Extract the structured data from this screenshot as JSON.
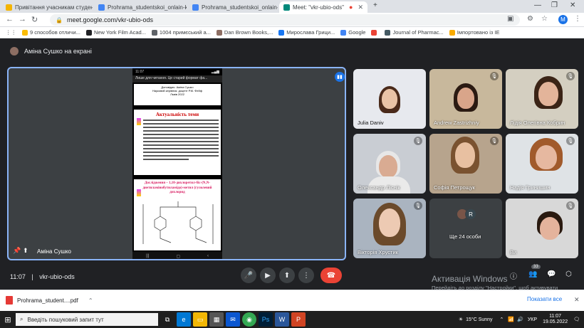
{
  "browser": {
    "tabs": [
      {
        "title": "Привітання учасникам студенті",
        "color": "#f4b400",
        "active": false
      },
      {
        "title": "Prohrama_studentskoi_onlain-k",
        "color": "#4285f4",
        "active": false
      },
      {
        "title": "Prohrama_studentskoi_onlain-k",
        "color": "#4285f4",
        "active": false
      },
      {
        "title": "Meet: \"vkr-ubio-ods\"",
        "color": "#00897b",
        "active": true
      }
    ],
    "new_tab": "+",
    "url": "meet.google.com/vkr-ubio-ods",
    "profile_initial": "M",
    "bookmarks": [
      {
        "label": "9 способов отличи...",
        "color": "#fbbc04"
      },
      {
        "label": "New York Film Acad...",
        "color": "#202124"
      },
      {
        "label": "1004 примєський а...",
        "color": "#5f6368"
      },
      {
        "label": "Dan Brown Books,...",
        "color": "#8d6e63"
      },
      {
        "label": "Мирослава Грици...",
        "color": "#1877f2"
      },
      {
        "label": "Google",
        "color": "#4285f4"
      },
      {
        "label": "",
        "color": "#ea4335"
      },
      {
        "label": "Journal of Pharmac...",
        "color": "#455a64"
      },
      {
        "label": "Імпортовано із IE",
        "color": "#f9ab00"
      }
    ]
  },
  "meet": {
    "presenting_banner": "Аміна Сушко на екрані",
    "presenter_name": "Аміна Сушко",
    "phone_time": "11:07",
    "reading_mode": "Лише для читання. Це старий формат фа...",
    "slide1_lines": [
      "Доповідач: Аміна Сушко",
      "Науковий керівник: доцент Р.М. Фейф",
      "Львів 2022"
    ],
    "slide2_title": "Актуальність теми",
    "slide3_title": "Дослідження – 1,10-дихлоретил-біс-(N,N-диетиламінобутиламідо)-метил (гулолевий дихлорид",
    "meeting_time": "11:07",
    "meeting_code": "vkr-ubio-ods",
    "participants_count": "33",
    "tiles": [
      {
        "name": "Julia Daniv",
        "bg": "#e7e9ee",
        "skin": "#e9c3a6",
        "hair": "#4a2a1a"
      },
      {
        "name": "Andrew Zastrizhniy",
        "bg": "#c8b89c",
        "skin": "#d9a58a",
        "hair": "#2b1a12"
      },
      {
        "name": "Лідія Олегівна Кобрин",
        "bg": "#d4cfc1",
        "skin": "#e3b49a",
        "hair": "#3b2416"
      },
      {
        "name": "Олександр Ліснік",
        "bg": "#c9cdd3",
        "skin": "#d9ab92",
        "hair": "#e7e7e7"
      },
      {
        "name": "Софія Петрощук",
        "bg": "#b7a48d",
        "skin": "#e8c0a1",
        "hair": "#7a5230"
      },
      {
        "name": "Надія Гринишин",
        "bg": "#dfe3e6",
        "skin": "#e6b8a0",
        "hair": "#a15a2b"
      },
      {
        "name": "Вікторія Хрустик",
        "bg": "#aab4c0",
        "skin": "#edcab3",
        "hair": "#6b4a2b"
      },
      {
        "name": "Ще 24 особи",
        "bg": "#3c4043",
        "skin": "",
        "hair": ""
      },
      {
        "name": "Ви",
        "bg": "#d8d8d8",
        "skin": "#e4b39c",
        "hair": "#2a1a10"
      }
    ],
    "others_avatars": [
      {
        "initial": "",
        "color": "#795548"
      },
      {
        "initial": "R",
        "color": "#37474f"
      }
    ],
    "activation_title": "Активація Windows",
    "activation_desc": "Перейдіть до розділу \"Настройки\", щоб активувати Windows."
  },
  "downloads": {
    "file": "Prohrama_student....pdf",
    "show_all": "Показати все"
  },
  "taskbar": {
    "search_placeholder": "Введіть пошуковий запит тут",
    "weather": "15°C Sunny",
    "lang": "УКР",
    "time": "11:07",
    "date": "19.05.2022"
  }
}
